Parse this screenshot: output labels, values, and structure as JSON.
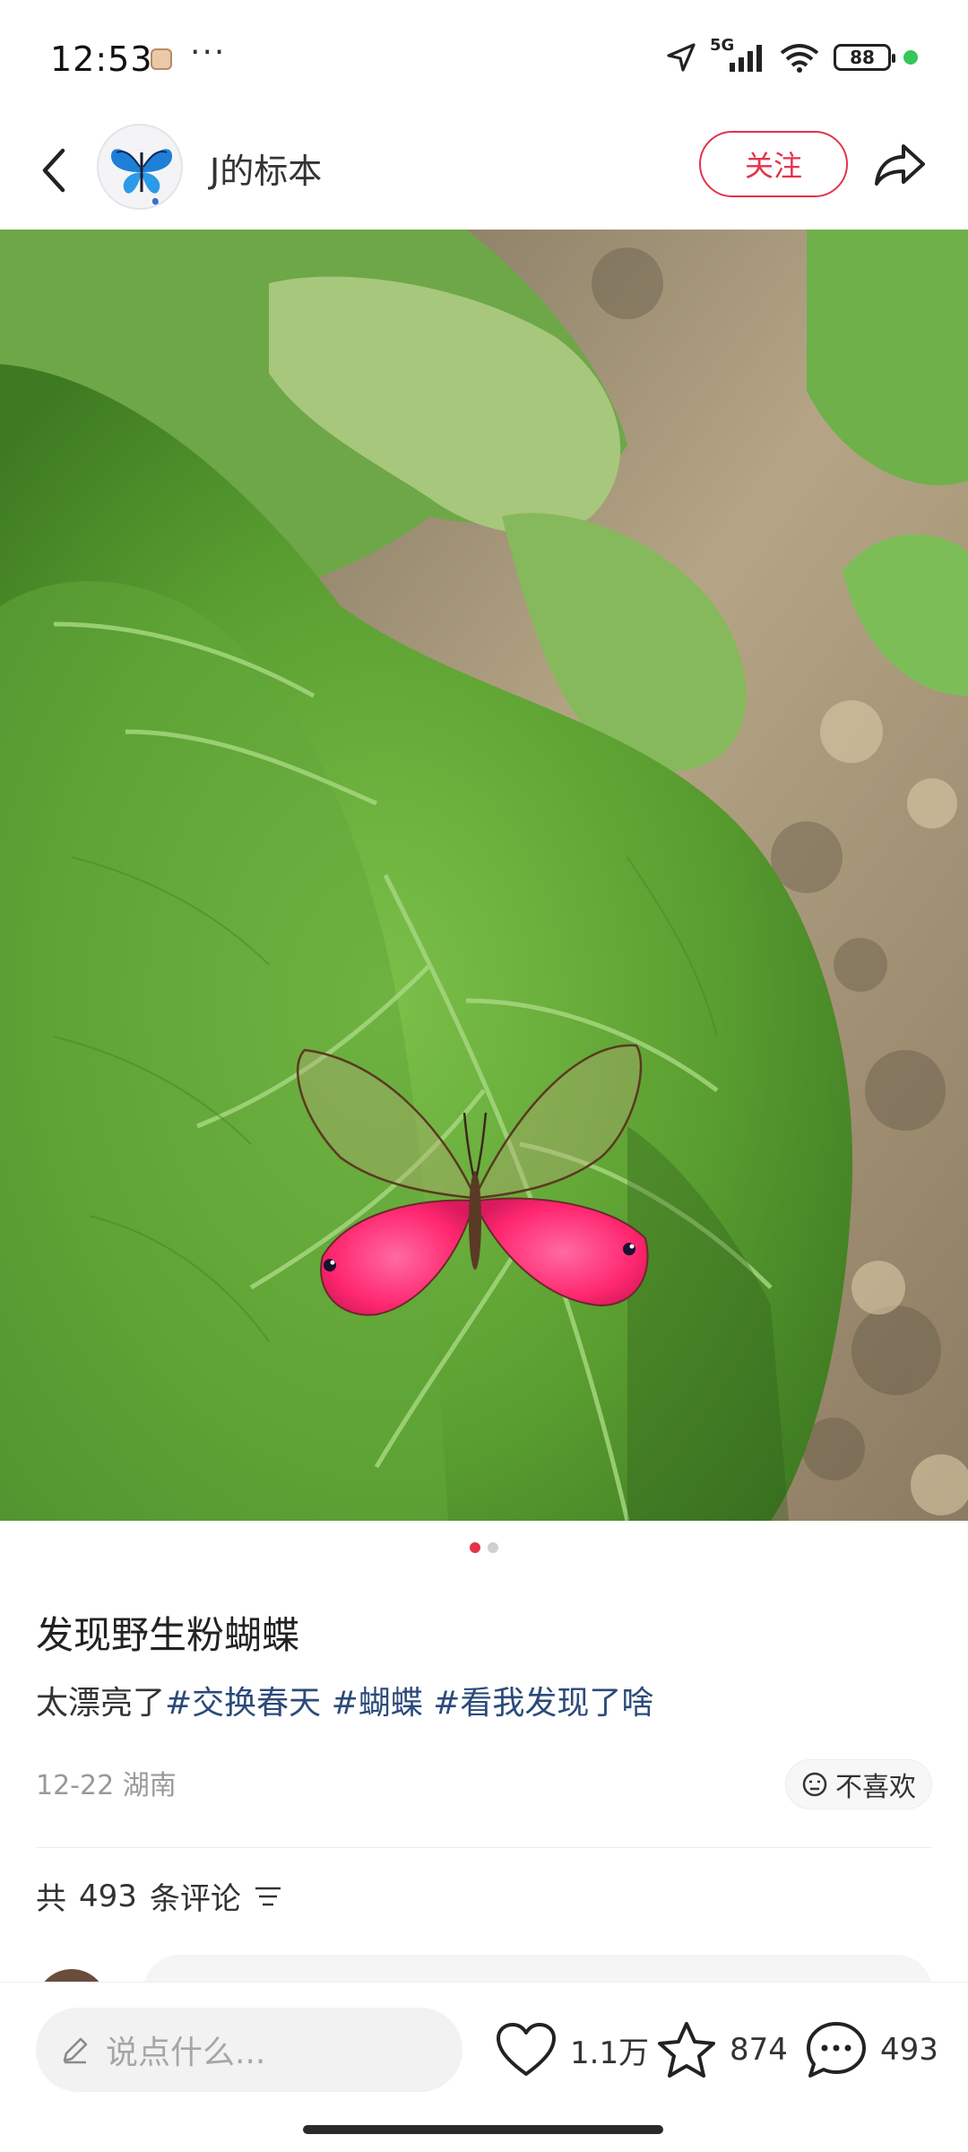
{
  "status_bar": {
    "time": "12:53",
    "dots": "···",
    "network": "5G",
    "battery": "88"
  },
  "header": {
    "author_name": "J的标本",
    "follow_label": "关注"
  },
  "post": {
    "page_indicator": {
      "count": 2,
      "active": 1
    },
    "title": "发现野生粉蝴蝶",
    "desc_text": "太漂亮了",
    "tags": [
      "#交换春天",
      "#蝴蝶",
      "#看我发现了啥"
    ],
    "date": "12-22",
    "location": "湖南",
    "dislike_label": "不喜欢"
  },
  "comments": {
    "prefix": "共",
    "count": "493",
    "suffix": "条评论"
  },
  "bottom_bar": {
    "input_placeholder": "说点什么...",
    "likes": "1.1万",
    "favorites": "874",
    "comments": "493"
  },
  "colors": {
    "accent": "#e3334a",
    "tag": "#2b4a7a",
    "leaf": "#5c9e3a",
    "soil": "#9e8a6e",
    "wing_pink": "#ff2f7a"
  },
  "icons": [
    "back-icon",
    "share-icon",
    "location-arrow-icon",
    "signal-icon",
    "wifi-icon",
    "battery-icon",
    "dislike-face-icon",
    "sort-filter-icon",
    "pencil-icon",
    "heart-icon",
    "star-icon",
    "chat-bubble-icon"
  ]
}
